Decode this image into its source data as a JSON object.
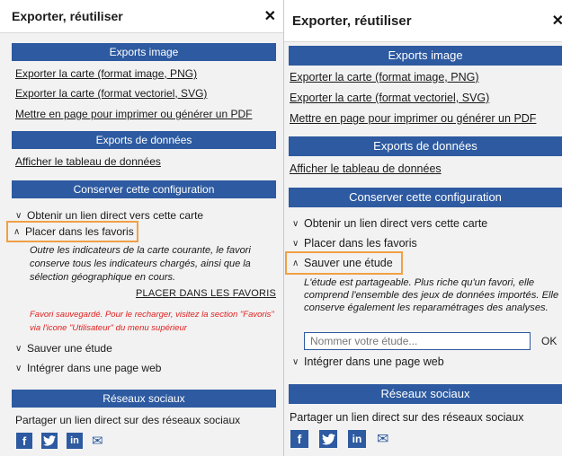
{
  "left": {
    "title": "Exporter, réutiliser",
    "close_glyph": "✕",
    "sections": {
      "exports_image": "Exports image",
      "exports_data": "Exports de données",
      "conserver": "Conserver cette configuration",
      "social": "Réseaux sociaux"
    },
    "links": {
      "png": "Exporter la carte (format image, PNG)",
      "svg": "Exporter la carte (format vectoriel, SVG)",
      "pdf": "Mettre en page pour imprimer ou générer un PDF",
      "table": "Afficher le tableau de données"
    },
    "accordion": {
      "direct_link": "Obtenir un lien direct vers cette carte",
      "favoris": "Placer dans les favoris",
      "sauver": "Sauver une étude",
      "integrer": "Intégrer dans une page web"
    },
    "favoris_desc": "Outre les indicateurs de la carte courante, le favori conserve tous les indicateurs chargés, ainsi que la sélection géographique en cours.",
    "favoris_action": "PLACER DANS LES FAVORIS",
    "favoris_saved": "Favori sauvegardé. Pour le recharger, visitez la section \"Favoris\" via l'icone \"Utilisateur\" du menu supérieur",
    "share_text": "Partager un lien direct sur des réseaux sociaux"
  },
  "right": {
    "title": "Exporter, réutiliser",
    "close_glyph": "✕",
    "sections": {
      "exports_image": "Exports image",
      "exports_data": "Exports de données",
      "conserver": "Conserver cette configuration",
      "social": "Réseaux sociaux"
    },
    "links": {
      "png": "Exporter la carte (format image, PNG)",
      "svg": "Exporter la carte (format vectoriel, SVG)",
      "pdf": "Mettre en page pour imprimer ou générer un PDF",
      "table": "Afficher le tableau de données"
    },
    "accordion": {
      "direct_link": "Obtenir un lien direct vers cette carte",
      "favoris": "Placer dans les favoris",
      "sauver": "Sauver une étude",
      "integrer": "Intégrer dans une page web"
    },
    "etude_desc": "L'étude est partageable. Plus riche qu'un favori, elle comprend l'ensemble des jeux de données importés. Elle conserve également les reparamétrages des analyses.",
    "study_placeholder": "Nommer votre étude...",
    "ok_label": "OK",
    "share_text": "Partager un lien direct sur des réseaux sociaux"
  },
  "icons": {
    "facebook": "f",
    "twitter": "twitter-bird",
    "linkedin": "in",
    "email": "✉",
    "chevron_down": "∨",
    "chevron_up": "∧"
  },
  "colors": {
    "section_bar": "#2d5aa0",
    "highlight": "#f0a045",
    "saved_note": "#e02020",
    "panel_bg": "#f2f2f2"
  }
}
